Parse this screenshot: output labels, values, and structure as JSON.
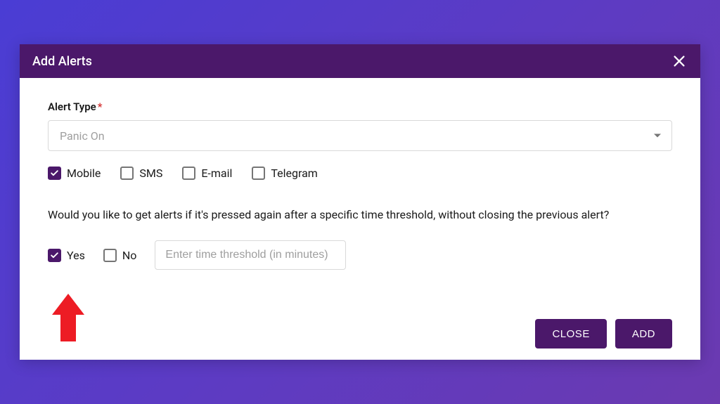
{
  "modal": {
    "title": "Add Alerts"
  },
  "form": {
    "alert_type_label": "Alert Type",
    "alert_type_value": "Panic On",
    "channels": {
      "mobile": {
        "label": "Mobile",
        "checked": true
      },
      "sms": {
        "label": "SMS",
        "checked": false
      },
      "email": {
        "label": "E-mail",
        "checked": false
      },
      "telegram": {
        "label": "Telegram",
        "checked": false
      }
    },
    "question": "Would you like to get alerts if it's pressed again after a specific time threshold, without closing the previous alert?",
    "yes_label": "Yes",
    "no_label": "No",
    "yes_checked": true,
    "no_checked": false,
    "threshold_placeholder": "Enter time threshold (in minutes)",
    "threshold_value": ""
  },
  "buttons": {
    "close": "CLOSE",
    "add": "ADD"
  }
}
